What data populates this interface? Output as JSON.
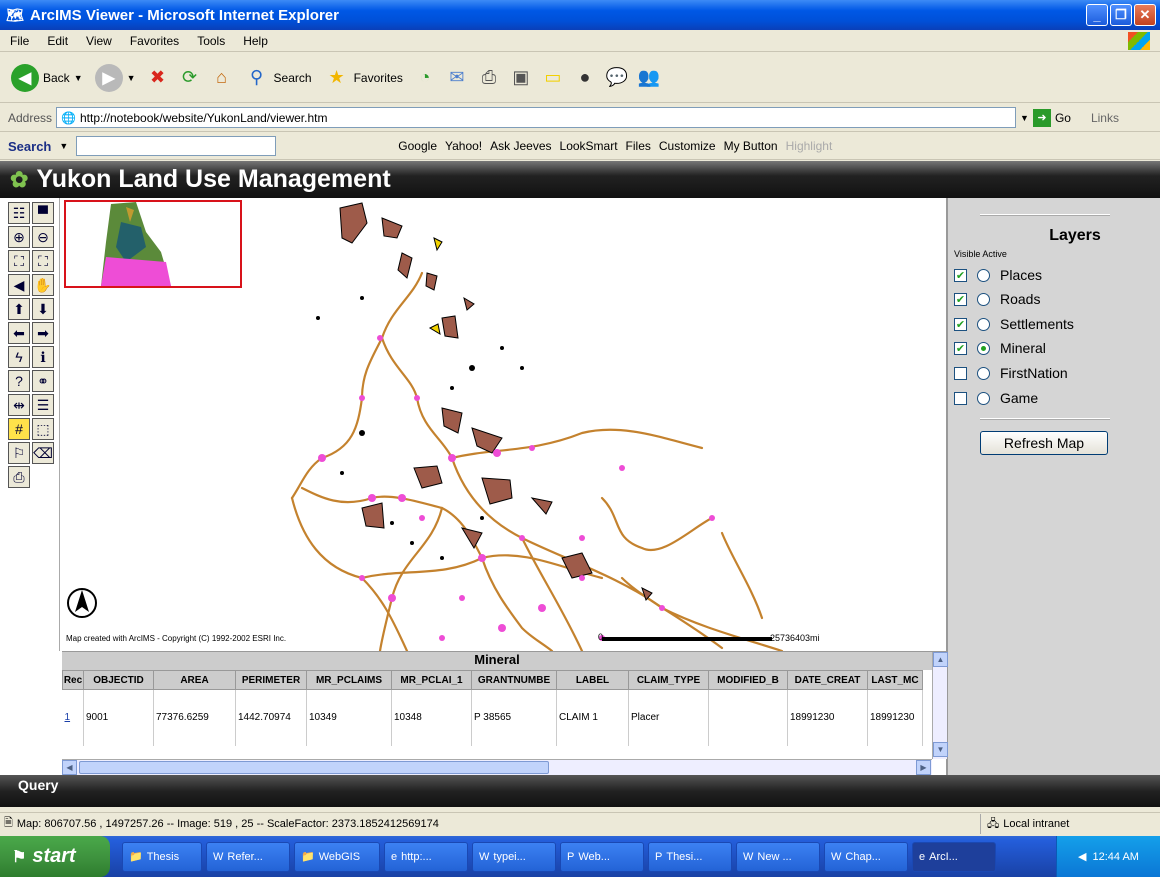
{
  "window": {
    "title": "ArcIMS Viewer - Microsoft Internet Explorer"
  },
  "menu": [
    "File",
    "Edit",
    "View",
    "Favorites",
    "Tools",
    "Help"
  ],
  "toolbar": {
    "back": "Back",
    "search": "Search",
    "favorites": "Favorites"
  },
  "address": {
    "label": "Address",
    "url": "http://notebook/website/YukonLand/viewer.htm",
    "go": "Go",
    "links": "Links"
  },
  "searchbar": {
    "label": "Search",
    "items": [
      "Google",
      "Yahoo!",
      "Ask Jeeves",
      "LookSmart",
      "Files",
      "Customize",
      "My Button",
      "Highlight"
    ]
  },
  "page": {
    "title": "Yukon Land Use Management"
  },
  "map": {
    "copyright": "Map created with ArcIMS - Copyright (C) 1992-2002 ESRI Inc.",
    "scale_value": "0",
    "scale_end": "25736403mi"
  },
  "layers": {
    "title": "Layers",
    "visible_active": "Visible Active",
    "items": [
      {
        "name": "Places",
        "visible": true,
        "active": false
      },
      {
        "name": "Roads",
        "visible": true,
        "active": false
      },
      {
        "name": "Settlements",
        "visible": true,
        "active": false
      },
      {
        "name": "Mineral",
        "visible": true,
        "active": true
      },
      {
        "name": "FirstNation",
        "visible": false,
        "active": false
      },
      {
        "name": "Game",
        "visible": false,
        "active": false
      }
    ],
    "refresh": "Refresh Map"
  },
  "results": {
    "title": "Mineral",
    "columns": [
      "Rec",
      "OBJECTID",
      "AREA",
      "PERIMETER",
      "MR_PCLAIMS",
      "MR_PCLAI_1",
      "GRANTNUMBE",
      "LABEL",
      "CLAIM_TYPE",
      "MODIFIED_B",
      "DATE_CREAT",
      "LAST_MC"
    ],
    "row": [
      "1",
      "9001",
      "77376.6259",
      "1442.70974",
      "10349",
      "10348",
      "P 38565",
      "CLAIM 1",
      "Placer",
      "",
      "18991230",
      "18991230"
    ]
  },
  "query": {
    "label": "Query"
  },
  "status": {
    "text": "Map: 806707.56 , 1497257.26 -- Image: 519 , 25 -- ScaleFactor: 2373.1852412569174",
    "zone": "Local intranet"
  },
  "taskbar": {
    "start": "start",
    "tasks": [
      "Thesis",
      "Refer...",
      "WebGIS",
      "http:...",
      "typei...",
      "Web...",
      "Thesi...",
      "New ...",
      "Chap...",
      "ArcI..."
    ],
    "clock": "12:44 AM"
  }
}
